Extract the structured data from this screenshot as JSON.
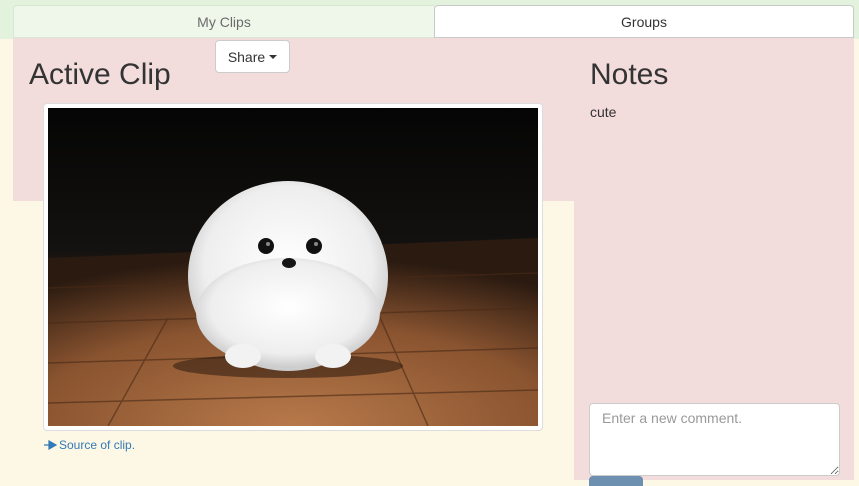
{
  "tabs": [
    {
      "label": "My Clips"
    },
    {
      "label": "Groups"
    }
  ],
  "share_label": "Share",
  "active_clip": {
    "title": "Active Clip",
    "image_alt": "white fluffy puppy on wooden floor",
    "source_label": "Source of clip."
  },
  "notes": {
    "title": "Notes",
    "text": "cute"
  },
  "comment": {
    "placeholder": "Enter a new comment."
  },
  "colors": {
    "page_bg": "#fdf7e5",
    "panel_pink": "#f2dcdc",
    "tabbar_green": "#e3f2dc",
    "link": "#337ab7"
  }
}
